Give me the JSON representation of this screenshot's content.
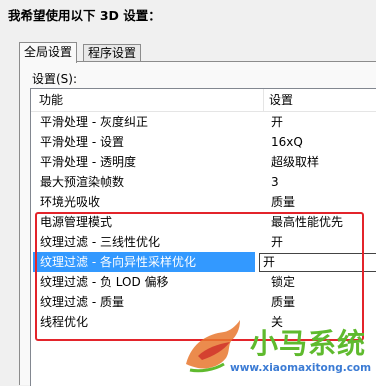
{
  "heading": "我希望使用以下 3D 设置：",
  "tabs": [
    {
      "label": "全局设置",
      "active": true
    },
    {
      "label": "程序设置",
      "active": false
    }
  ],
  "settings_label": "设置(S):",
  "columns": {
    "feature": "功能",
    "setting": "设置"
  },
  "rows": [
    {
      "feature": "平滑处理 - 灰度纠正",
      "value": "开"
    },
    {
      "feature": "平滑处理 - 设置",
      "value": "16xQ"
    },
    {
      "feature": "平滑处理 - 透明度",
      "value": "超级取样"
    },
    {
      "feature": "最大预渲染帧数",
      "value": "3"
    },
    {
      "feature": "环境光吸收",
      "value": "质量"
    },
    {
      "feature": "电源管理模式",
      "value": "最高性能优先"
    },
    {
      "feature": "纹理过滤 - 三线性优化",
      "value": "开"
    },
    {
      "feature": "纹理过滤 - 各向异性采样优化",
      "value": "开",
      "selected": true
    },
    {
      "feature": "纹理过滤 - 负 LOD 偏移",
      "value": "锁定"
    },
    {
      "feature": "纹理过滤 - 质量",
      "value": "质量"
    },
    {
      "feature": "线程优化",
      "value": "关"
    }
  ],
  "watermark": {
    "brand": "小马系统",
    "url": "www.xiaomaxitong.com"
  },
  "colors": {
    "selection": "#3399ff",
    "highlight_border": "#e3242b",
    "watermark_green": "#5fba2e",
    "watermark_blue": "#3b7bd4"
  }
}
